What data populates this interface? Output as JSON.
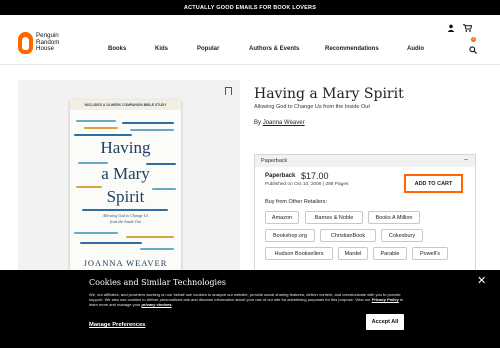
{
  "promo": {
    "text": "ACTUALLY GOOD EMAILS FOR BOOK LOVERS"
  },
  "brand": {
    "line1": "Penguin",
    "line2": "Random",
    "line3": "House"
  },
  "nav": {
    "books": "Books",
    "kids": "Kids",
    "popular": "Popular",
    "authors_events": "Authors & Events",
    "recommendations": "Recommendations",
    "audio": "Audio"
  },
  "header": {
    "cart_count": "0"
  },
  "cover": {
    "banner": "INCLUDES A 10-WEEK COMPANION BIBLE STUDY",
    "title_line1": "Having",
    "title_line2": "a Mary",
    "title_line3": "Spirit",
    "subtitle_line1": "Allowing God to Change Us",
    "subtitle_line2": "from the Inside Out",
    "author": "JOANNA WEAVER",
    "colors": {
      "blue": "#2f6fa3",
      "teal": "#67a9c8",
      "gold": "#d9a441",
      "navy": "#1f3f62"
    }
  },
  "book": {
    "title": "Having a Mary Spirit",
    "subtitle": "Allowing God to Change Us from the Inside Out",
    "by": "By",
    "author": "Joanna Weaver"
  },
  "purchase": {
    "format_bar": "Paperback",
    "collapse": "−",
    "format": "Paperback",
    "price": "$17.00",
    "meta": "Published on Oct 10, 2006 | 288 Pages",
    "add_to_cart": "ADD TO CART",
    "buy_from": "Buy from Other Retailers:",
    "retailers": [
      "Amazon",
      "Barnes & Noble",
      "Books A Million",
      "Bookshop.org",
      "ChristianBook",
      "Cokesbury",
      "Hudson Booksellers",
      "Mardel",
      "Parable",
      "Powell's"
    ],
    "accent": "#ff6600"
  },
  "cookie": {
    "title": "Cookies and Similar Technologies",
    "body_1": "We, our affiliates, and providers working on our behalf use cookies to analyze our website, provide social sharing features, deliver content, and communicate with you to provide support. We also use cookies to deliver personalized ads and disclose information about your use of our site for advertising purposes for this purpose. View our ",
    "privacy_policy": "Privacy Policy",
    "body_2": " to learn more and manage your ",
    "privacy_choices": "privacy choices",
    "manage": "Manage Preferences",
    "accept": "Accept All",
    "close": "✕"
  }
}
